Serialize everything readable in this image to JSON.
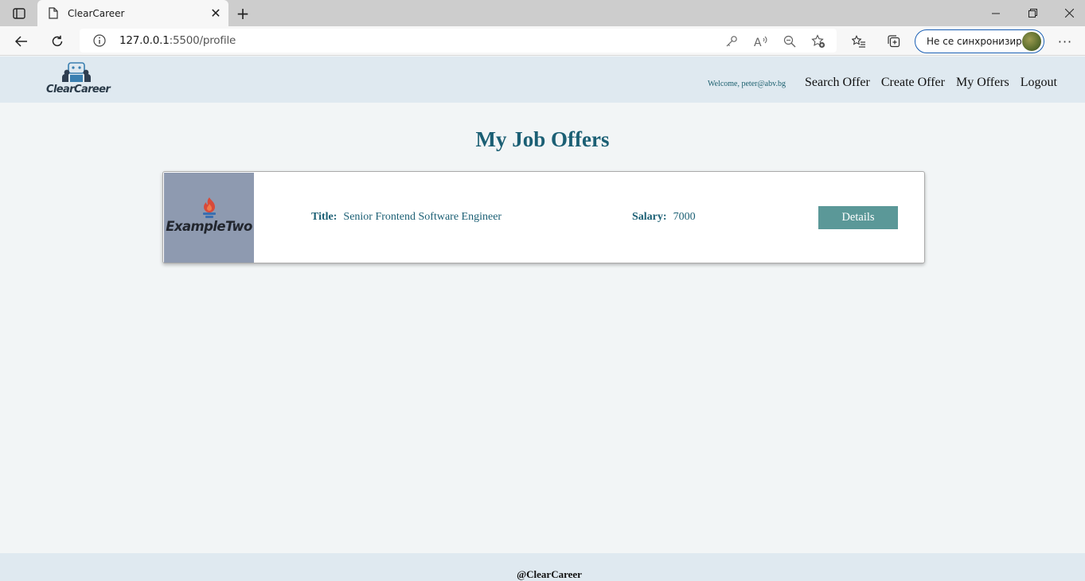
{
  "browser": {
    "tab_title": "ClearCareer",
    "url_host": "127.0.0.1",
    "url_path": ":5500/profile",
    "profile_label": "Не се синхронизира"
  },
  "header": {
    "logo_text": "ClearCareer",
    "welcome": "Welcome, peter@abv.bg",
    "nav": [
      "Search Offer",
      "Create Offer",
      "My Offers",
      "Logout"
    ]
  },
  "main": {
    "title": "My Job Offers",
    "offers": [
      {
        "company": "ExampleTwo",
        "title_label": "Title:",
        "title": "Senior Frontend Software Engineer",
        "salary_label": "Salary:",
        "salary": "7000",
        "details_label": "Details"
      }
    ]
  },
  "footer": {
    "text": "@ClearCareer"
  },
  "colors": {
    "accent": "#1b5f74",
    "button": "#5b9898",
    "header_bg": "#dfe9f0",
    "page_bg": "#f2f5f6"
  }
}
